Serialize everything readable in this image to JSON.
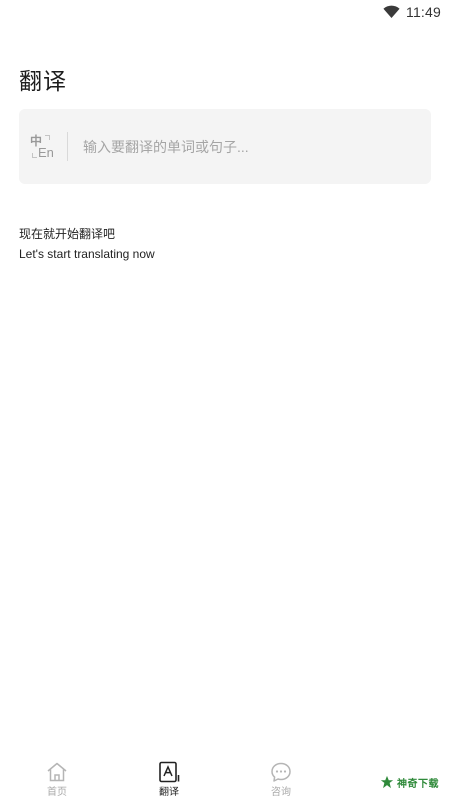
{
  "status_bar": {
    "time": "11:49",
    "icons": [
      "wifi-icon"
    ]
  },
  "page": {
    "title": "翻译"
  },
  "input_card": {
    "lang_from": "中",
    "lang_to": "En",
    "placeholder": "输入要翻译的单词或句子..."
  },
  "hint": {
    "chinese": "现在就开始翻译吧",
    "english": "Let's start translating now"
  },
  "tab_bar": {
    "tabs": [
      {
        "label": "首页",
        "icon": "home-icon",
        "active": false
      },
      {
        "label": "翻译",
        "icon": "translate-icon",
        "active": true
      },
      {
        "label": "咨询",
        "icon": "chat-icon",
        "active": false
      }
    ]
  },
  "watermark": {
    "text": "神奇下载",
    "icon": "logo-icon",
    "color": "#2f8a3a"
  }
}
